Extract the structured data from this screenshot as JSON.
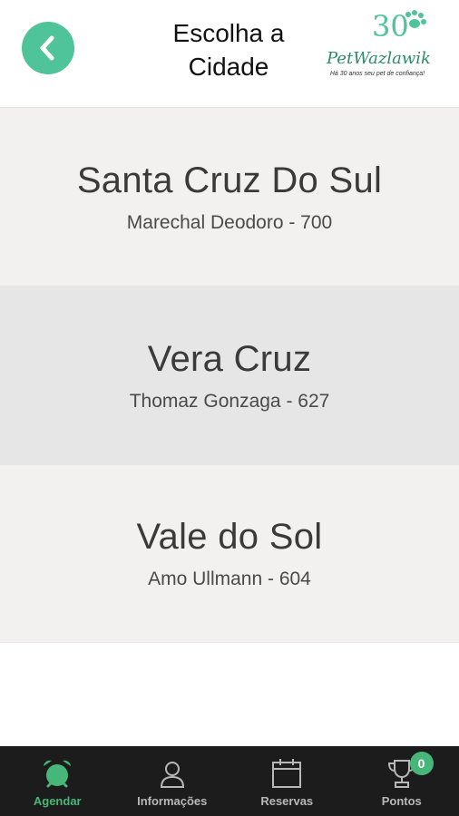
{
  "header": {
    "title_line1": "Escolha a",
    "title_line2": "Cidade",
    "logo_text": "PetWazlawik",
    "logo_number": "30",
    "logo_tagline": "Há 30 anos seu pet de confiança!"
  },
  "cities": [
    {
      "name": "Santa Cruz Do Sul",
      "address": "Marechal Deodoro - 700"
    },
    {
      "name": "Vera Cruz",
      "address": "Thomaz Gonzaga - 627"
    },
    {
      "name": "Vale do Sol",
      "address": "Amo Ullmann - 604"
    }
  ],
  "tabs": [
    {
      "label": "Agendar",
      "icon": "alarm-clock-icon",
      "active": true
    },
    {
      "label": "Informações",
      "icon": "user-icon",
      "active": false
    },
    {
      "label": "Reservas",
      "icon": "calendar-icon",
      "active": false
    },
    {
      "label": "Pontos",
      "icon": "trophy-icon",
      "active": false,
      "badge": "0"
    }
  ],
  "colors": {
    "accent": "#4fc39a",
    "active_tab": "#46b779",
    "tabbar_bg": "#1c1c1c"
  }
}
